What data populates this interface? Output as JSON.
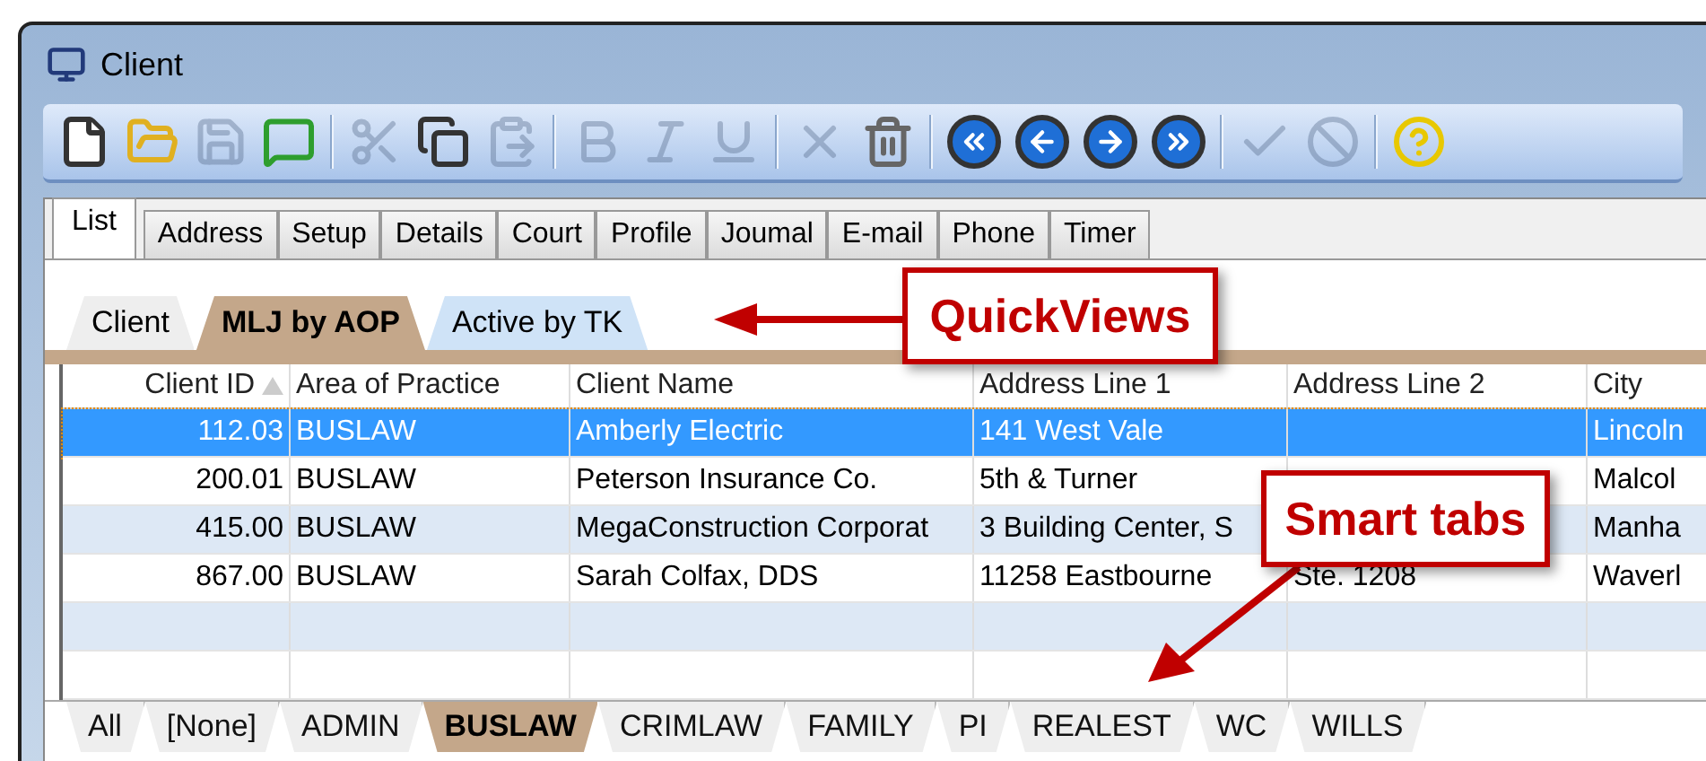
{
  "window": {
    "title": "Client"
  },
  "toolbar": {
    "groups": [
      [
        {
          "disabled": false
        },
        {
          "disabled": false
        },
        {
          "disabled": true
        },
        {
          "disabled": false
        }
      ],
      [
        {
          "disabled": true
        },
        {
          "disabled": false
        },
        {
          "disabled": true
        }
      ],
      [
        {
          "disabled": true
        },
        {
          "disabled": true
        },
        {
          "disabled": true
        }
      ],
      [
        {
          "disabled": true
        },
        {
          "disabled": false
        }
      ],
      [
        {
          "disabled": false
        },
        {
          "disabled": false
        },
        {
          "disabled": false
        },
        {
          "disabled": false
        }
      ],
      [
        {
          "disabled": true
        },
        {
          "disabled": true
        }
      ],
      [
        {
          "disabled": false
        }
      ]
    ]
  },
  "tabs": [
    {
      "label": "List",
      "selected": true
    },
    {
      "label": "Address",
      "selected": false
    },
    {
      "label": "Setup",
      "selected": false
    },
    {
      "label": "Details",
      "selected": false
    },
    {
      "label": "Court",
      "selected": false
    },
    {
      "label": "Profile",
      "selected": false
    },
    {
      "label": "Joumal",
      "selected": false
    },
    {
      "label": "E-mail",
      "selected": false
    },
    {
      "label": "Phone",
      "selected": false
    },
    {
      "label": "Timer",
      "selected": false
    }
  ],
  "quickviews": [
    {
      "label": "Client",
      "selected": false
    },
    {
      "label": "MLJ by AOP",
      "selected": true
    },
    {
      "label": "Active by TK",
      "selected": false
    }
  ],
  "table": {
    "columns": [
      {
        "label": "Client ID",
        "sorted": true
      },
      {
        "label": "Area of Practice",
        "sorted": false
      },
      {
        "label": "Client Name",
        "sorted": false
      },
      {
        "label": "Address Line 1",
        "sorted": false
      },
      {
        "label": "Address Line 2",
        "sorted": false
      },
      {
        "label": "City",
        "sorted": false
      }
    ],
    "rows": [
      {
        "selected": true,
        "cells": [
          "112.03",
          "BUSLAW",
          "Amberly Electric",
          "141 West Vale",
          "",
          "Lincoln"
        ]
      },
      {
        "selected": false,
        "cells": [
          "200.01",
          "BUSLAW",
          "Peterson Insurance Co.",
          "5th & Turner",
          "",
          "Malcol"
        ]
      },
      {
        "selected": false,
        "cells": [
          "415.00",
          "BUSLAW",
          "MegaConstruction Corporat",
          "3 Building Center, S",
          "",
          "Manha"
        ]
      },
      {
        "selected": false,
        "cells": [
          "867.00",
          "BUSLAW",
          "Sarah Colfax, DDS",
          "11258 Eastbourne",
          "Ste. 1208",
          "Waverl"
        ]
      }
    ]
  },
  "smart_tabs": [
    {
      "label": "All",
      "selected": false
    },
    {
      "label": "[None]",
      "selected": false
    },
    {
      "label": "ADMIN",
      "selected": false
    },
    {
      "label": "BUSLAW",
      "selected": true
    },
    {
      "label": "CRIMLAW",
      "selected": false
    },
    {
      "label": "FAMILY",
      "selected": false
    },
    {
      "label": "PI",
      "selected": false
    },
    {
      "label": "REALEST",
      "selected": false
    },
    {
      "label": "WC",
      "selected": false
    },
    {
      "label": "WILLS",
      "selected": false
    }
  ],
  "callouts": [
    {
      "text": "QuickViews"
    },
    {
      "text": "Smart tabs"
    }
  ]
}
